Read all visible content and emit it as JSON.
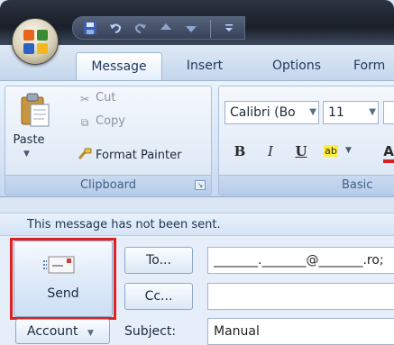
{
  "qat": {
    "save_icon": "save-icon",
    "undo_icon": "undo-icon",
    "redo_icon": "redo-icon",
    "up_icon": "arrow-up-icon",
    "down_icon": "arrow-down-icon",
    "customize_icon": "customize-qat-icon"
  },
  "tabs": [
    {
      "label": "Message",
      "active": true
    },
    {
      "label": "Insert"
    },
    {
      "label": "Options"
    },
    {
      "label": "Form"
    }
  ],
  "ribbon": {
    "clipboard": {
      "paste_label": "Paste",
      "cut_label": "Cut",
      "copy_label": "Copy",
      "format_painter_label": "Format Painter",
      "group_label": "Clipboard"
    },
    "basic_text": {
      "font_name": "Calibri (Bo",
      "font_size": "11",
      "bold": "B",
      "italic": "I",
      "underline": "U",
      "highlight": "ab",
      "font_color": "A",
      "group_label": "Basic"
    }
  },
  "message": {
    "info_text": "This message has not been sent.",
    "send_label": "Send",
    "to_label": "To...",
    "cc_label": "Cc...",
    "to_value": "_______._______@_______.ro;",
    "cc_value": "",
    "account_label": "Account",
    "subject_label": "Subject:",
    "subject_value": "Manual"
  },
  "colors": {
    "accent_red": "#dd2222",
    "font_color_red": "#d32020",
    "highlight_yellow": "#ffee33"
  }
}
